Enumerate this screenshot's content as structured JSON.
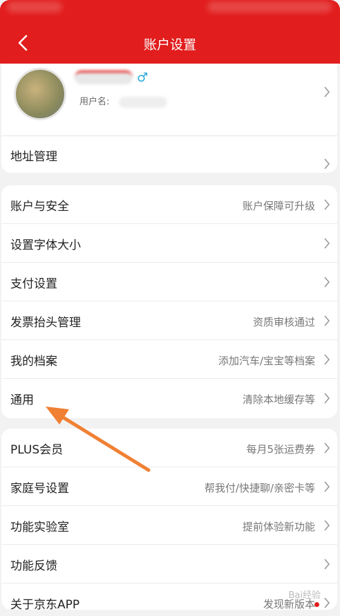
{
  "header": {
    "title": "账户设置"
  },
  "profile": {
    "gender_symbol": "♂",
    "username_label": "用户名:"
  },
  "address": {
    "label": "地址管理"
  },
  "group1": [
    {
      "label": "账户与安全",
      "hint": "账户保障可升级"
    },
    {
      "label": "设置字体大小",
      "hint": ""
    },
    {
      "label": "支付设置",
      "hint": ""
    },
    {
      "label": "发票抬头管理",
      "hint": "资质审核通过"
    },
    {
      "label": "我的档案",
      "hint": "添加汽车/宝宝等档案"
    },
    {
      "label": "通用",
      "hint": "清除本地缓存等"
    }
  ],
  "group2": [
    {
      "label": "PLUS会员",
      "hint": "每月5张运费券"
    },
    {
      "label": "家庭号设置",
      "hint": "帮我付/快捷聊/亲密卡等"
    },
    {
      "label": "功能实验室",
      "hint": "提前体验新功能"
    },
    {
      "label": "功能反馈",
      "hint": ""
    },
    {
      "label": "关于京东APP",
      "hint": "发现新版本"
    }
  ],
  "watermark": "Bai经验",
  "colors": {
    "brand_red": "#e21d1d",
    "arrow_orange": "#f08033",
    "gender_blue": "#26a8d8"
  }
}
